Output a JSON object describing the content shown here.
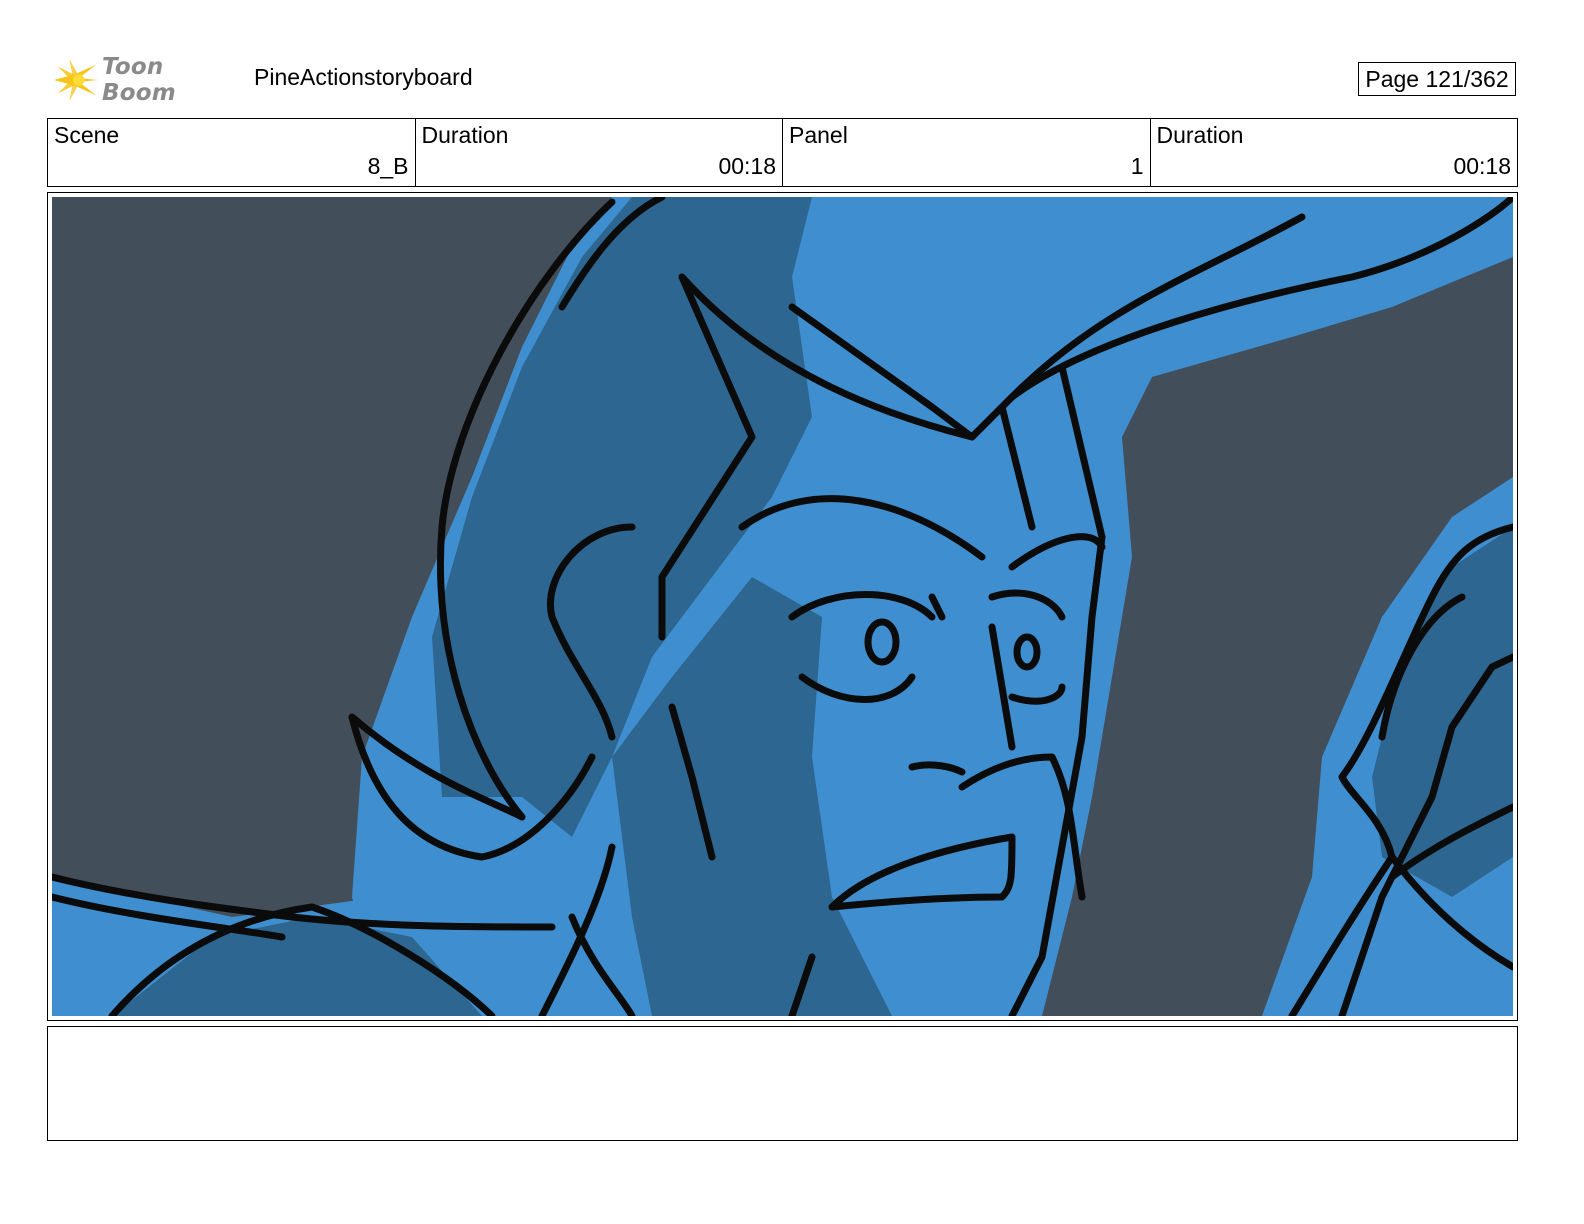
{
  "header": {
    "logo_text": "Toon Boom",
    "project_title": "PineActionstoryboard",
    "page_counter": "Page 121/362"
  },
  "info": {
    "scene_label": "Scene",
    "scene_value": "8_B",
    "scene_duration_label": "Duration",
    "scene_duration_value": "00:18",
    "panel_label": "Panel",
    "panel_value": "1",
    "panel_duration_label": "Duration",
    "panel_duration_value": "00:18"
  },
  "panel": {
    "background_color": "#424e5a",
    "light_blue": "#3f8fd0",
    "dark_blue": "#2d6690",
    "line_color": "#0b0b0b"
  },
  "notes": {
    "text": ""
  },
  "colors": {
    "logo_star": "#f5c518",
    "logo_text": "#8a8a8a",
    "border": "#000000"
  }
}
